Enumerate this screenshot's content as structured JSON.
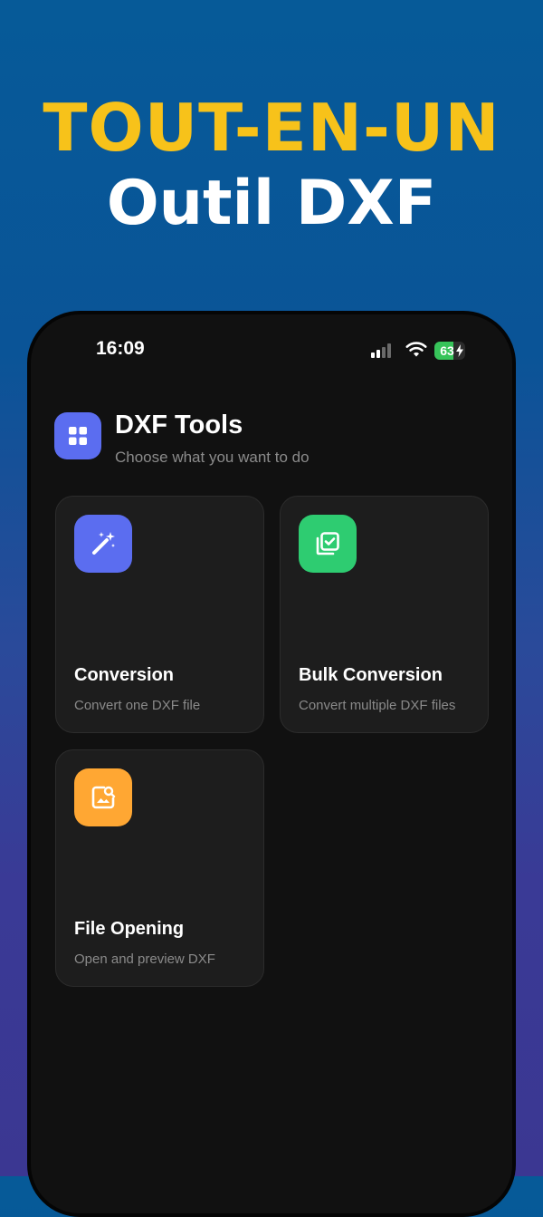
{
  "promo": {
    "line1": "TOUT-EN-UN",
    "line2": "Outil DXF"
  },
  "status_bar": {
    "time": "16:09",
    "battery_percent": "63",
    "battery_level": 0.63
  },
  "header": {
    "title": "DXF Tools",
    "subtitle": "Choose what you want to do",
    "icon": "grid-icon"
  },
  "cards": [
    {
      "title": "Conversion",
      "subtitle": "Convert one DXF file",
      "icon": "magic-wand-icon",
      "color": "#5b6df0"
    },
    {
      "title": "Bulk Conversion",
      "subtitle": "Convert multiple DXF files",
      "icon": "stacked-check-icon",
      "color": "#2ecc71"
    },
    {
      "title": "File Opening",
      "subtitle": "Open and preview DXF",
      "icon": "image-search-icon",
      "color": "#ffa733"
    }
  ],
  "colors": {
    "accent_yellow": "#f7c21a",
    "background_blue": "#065a98",
    "background_purple": "#3b3792",
    "phone_bg": "#111111"
  }
}
